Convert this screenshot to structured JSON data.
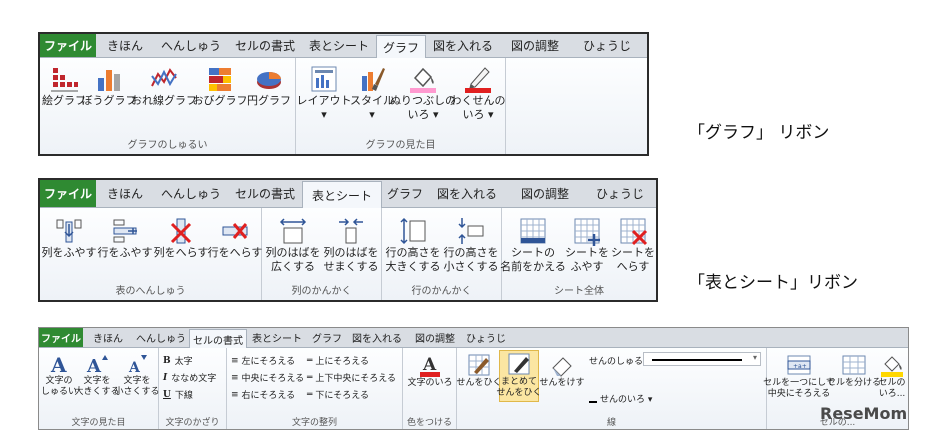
{
  "ribbon1": {
    "tabs": [
      "ファイル",
      "きほん",
      "へんしゅう",
      "セルの書式",
      "表とシート",
      "グラフ",
      "図を入れる",
      "図の調整",
      "ひょうじ"
    ],
    "active_tab": "グラフ",
    "groups": [
      {
        "label": "グラフのしゅるい",
        "buttons": [
          {
            "icon": "pictograph-chart-icon",
            "label": "絵グラフ"
          },
          {
            "icon": "bar-chart-icon",
            "label": "ぼうグラフ"
          },
          {
            "icon": "line-chart-icon",
            "label": "おれ線グラフ"
          },
          {
            "icon": "stacked-bar-chart-icon",
            "label": "おびグラフ"
          },
          {
            "icon": "pie-chart-icon",
            "label": "円グラフ"
          }
        ]
      },
      {
        "label": "グラフの見た目",
        "buttons": [
          {
            "icon": "layout-icon",
            "label": "レイアウト",
            "dropdown": "▾"
          },
          {
            "icon": "style-brush-icon",
            "label": "スタイル",
            "dropdown": "▾"
          },
          {
            "icon": "fill-bucket-icon",
            "label": "ぬりつぶしの",
            "label2": "いろ ▾"
          },
          {
            "icon": "pencil-line-icon",
            "label": "わくせんの",
            "label2": "いろ ▾"
          }
        ]
      }
    ],
    "caption": "「グラフ」 リボン"
  },
  "ribbon2": {
    "tabs": [
      "ファイル",
      "きほん",
      "へんしゅう",
      "セルの書式",
      "表とシート",
      "グラフ",
      "図を入れる",
      "図の調整",
      "ひょうじ"
    ],
    "active_tab": "表とシート",
    "groups": [
      {
        "label": "表のへんしゅう",
        "buttons": [
          {
            "icon": "insert-column-icon",
            "label": "列をふやす"
          },
          {
            "icon": "insert-row-icon",
            "label": "行をふやす"
          },
          {
            "icon": "delete-column-icon",
            "label": "列をへらす"
          },
          {
            "icon": "delete-row-icon",
            "label": "行をへらす"
          }
        ]
      },
      {
        "label": "列のかんかく",
        "buttons": [
          {
            "icon": "widen-column-icon",
            "label": "列のはばを",
            "label2": "広くする"
          },
          {
            "icon": "narrow-column-icon",
            "label": "列のはばを",
            "label2": "せまくする"
          }
        ]
      },
      {
        "label": "行のかんかく",
        "buttons": [
          {
            "icon": "taller-row-icon",
            "label": "行の高さを",
            "label2": "大きくする"
          },
          {
            "icon": "shorter-row-icon",
            "label": "行の高さを",
            "label2": "小さくする"
          }
        ]
      },
      {
        "label": "シート全体",
        "buttons": [
          {
            "icon": "rename-sheet-icon",
            "label": "シートの",
            "label2": "名前をかえる"
          },
          {
            "icon": "add-sheet-icon",
            "label": "シートを",
            "label2": "ふやす"
          },
          {
            "icon": "delete-sheet-icon",
            "label": "シートを",
            "label2": "へらす"
          }
        ]
      }
    ],
    "caption": "「表とシート」リボン"
  },
  "ribbon3": {
    "tabs": [
      "ファイル",
      "きほん",
      "へんしゅう",
      "セルの書式",
      "表とシート",
      "グラフ",
      "図を入れる",
      "図の調整",
      "ひょうじ"
    ],
    "active_tab": "セルの書式",
    "group_labels": [
      "文字の見た目",
      "文字のかざり",
      "文字の整列",
      "色をつける",
      "線",
      "セルの..."
    ],
    "size_buttons": [
      {
        "label": "文字の",
        "label2": "しゅるい"
      },
      {
        "label": "文字を",
        "label2": "大きくする"
      },
      {
        "label": "文字を",
        "label2": "小さくする"
      }
    ],
    "decoration": [
      {
        "glyph": "B",
        "label": "太字"
      },
      {
        "glyph": "I",
        "label": "ななめ文字"
      },
      {
        "glyph": "U",
        "label": "下線"
      }
    ],
    "align_left": [
      "左にそろえる",
      "中央にそろえる",
      "右にそろえる"
    ],
    "align_right": [
      "上にそろえる",
      "上下中央にそろえる",
      "下にそろえる"
    ],
    "color_button": {
      "label": "文字のいろ"
    },
    "line_buttons": [
      {
        "label": "せんをひく"
      },
      {
        "label": "まとめて",
        "label2": "せんをひく"
      },
      {
        "label": "せんをけす"
      }
    ],
    "line_type_label": "せんのしゅるい",
    "line_color_label": "せんのいろ ▾",
    "cell_buttons": [
      {
        "label": "セルを一つにして",
        "label2": "中央にそろえる"
      },
      {
        "label": "セルを分ける"
      },
      {
        "label": "セルの",
        "label2": "いろ..."
      }
    ],
    "watermark": "ReseMom"
  },
  "colors": {
    "file_tab": "#2f8a32",
    "accent_red": "#e02020",
    "pink": "#ff9ad0",
    "highlight": "#fbe6a2"
  }
}
